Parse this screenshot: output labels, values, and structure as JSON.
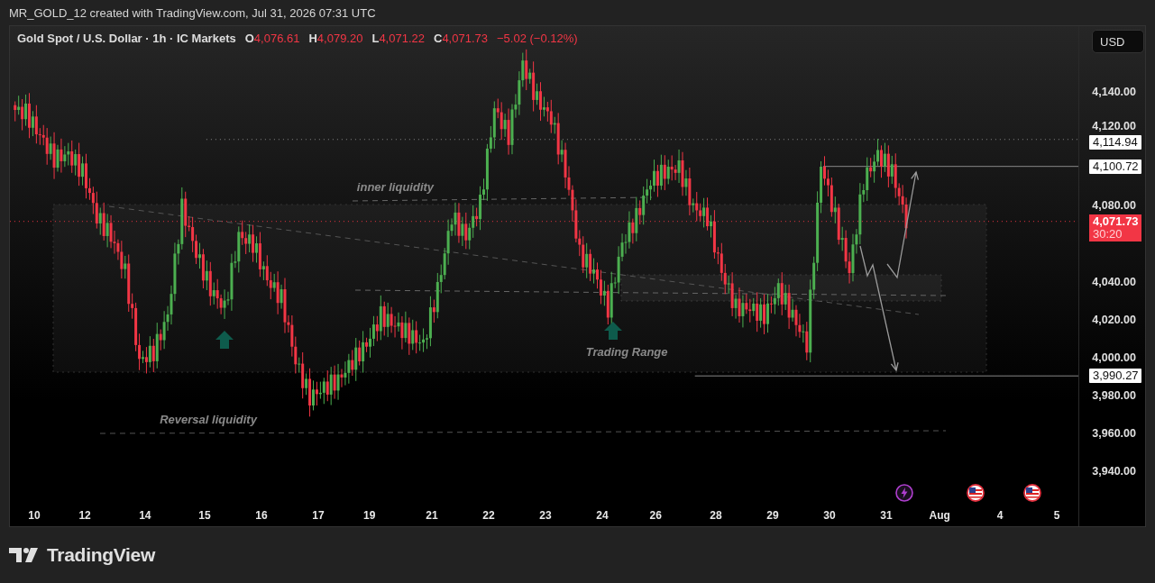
{
  "header": {
    "text": "MR_GOLD_12 created with TradingView.com, Jul 31, 2026 07:31 UTC"
  },
  "legend": {
    "symbol": "Gold Spot / U.S. Dollar · 1h · IC Markets",
    "ohlc": [
      {
        "key": "O",
        "value": "4,076.61"
      },
      {
        "key": "H",
        "value": "4,079.20"
      },
      {
        "key": "L",
        "value": "4,071.22"
      },
      {
        "key": "C",
        "value": "4,071.73"
      }
    ],
    "change": "−5.02 (−0.12%)"
  },
  "currency_button": "USD",
  "annotation_labels": [
    "inner liquidity",
    "Trading Range",
    "Reversal liquidity"
  ],
  "price_axis": {
    "labels": [
      "4,140.00",
      "4,120.00",
      "4,080.00",
      "4,040.00",
      "4,020.00",
      "4,000.00",
      "3,980.00",
      "3,960.00",
      "3,940.00"
    ]
  },
  "price_tags": [
    {
      "kind": "line",
      "text": "4,114.94"
    },
    {
      "kind": "line",
      "text": "4,100.72"
    },
    {
      "kind": "current",
      "text": "4,071.73",
      "timer": "30:20"
    },
    {
      "kind": "line",
      "text": "3,990.27"
    }
  ],
  "time_axis": {
    "labels": [
      "10",
      "12",
      "14",
      "15",
      "16",
      "17",
      "19",
      "21",
      "22",
      "23",
      "24",
      "26",
      "28",
      "29",
      "30",
      "31",
      "Aug",
      "4",
      "5"
    ]
  },
  "events": [
    {
      "kind": "lightning"
    },
    {
      "kind": "flag"
    },
    {
      "kind": "flag"
    }
  ],
  "footer": {
    "logo_text": "TradingView"
  }
}
